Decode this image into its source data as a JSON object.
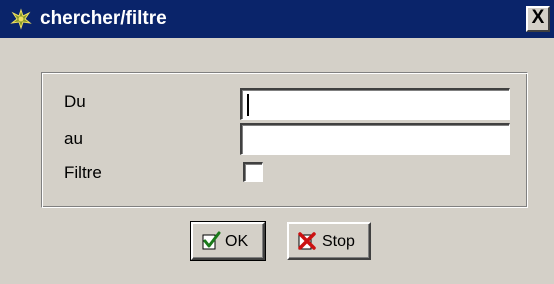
{
  "window": {
    "title": "chercher/filtre",
    "close_label": "X",
    "title_icon": "app-leaf-icon",
    "colors": {
      "titlebar": "#0a246a",
      "face": "#d4d0c8"
    }
  },
  "form": {
    "fields": [
      {
        "label": "Du",
        "value": ""
      },
      {
        "label": "au",
        "value": ""
      }
    ],
    "filter": {
      "label": "Filtre",
      "checked": false
    }
  },
  "buttons": {
    "ok": {
      "label": "OK",
      "icon": "checkmark-icon"
    },
    "stop": {
      "label": "Stop",
      "icon": "red-x-icon"
    }
  }
}
